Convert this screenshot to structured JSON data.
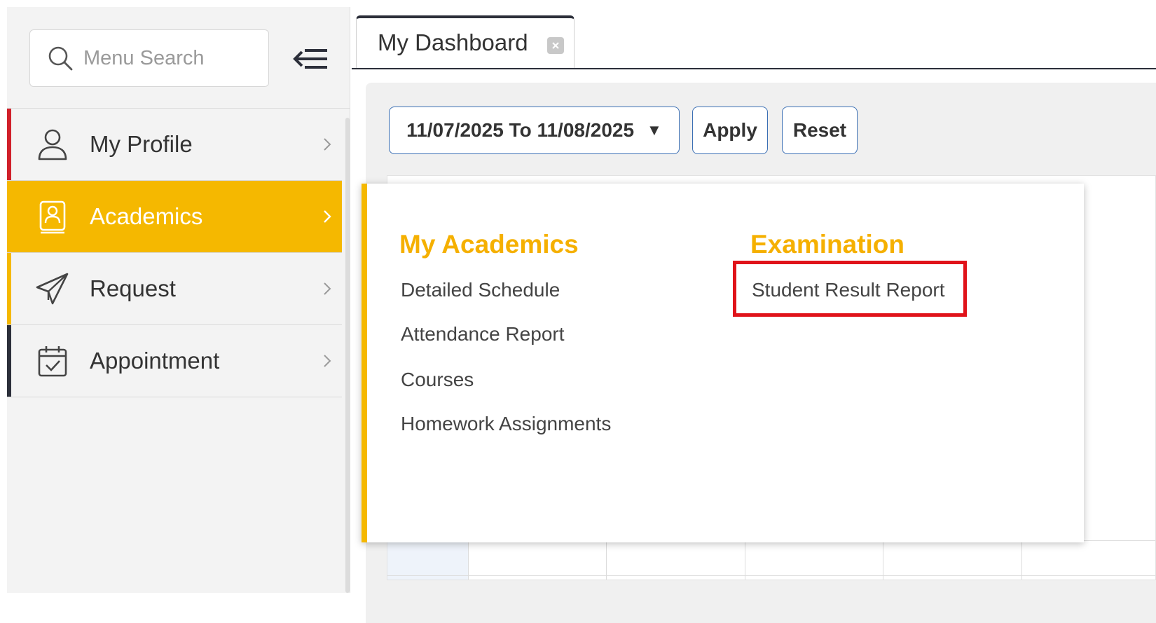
{
  "sidebar": {
    "search_placeholder": "Menu Search",
    "items": [
      {
        "label": "My Profile",
        "icon": "user-icon",
        "accent": "#d0202a"
      },
      {
        "label": "Academics",
        "icon": "academics-book-icon",
        "accent": "#f5b800"
      },
      {
        "label": "Request",
        "icon": "paper-plane-icon",
        "accent": "#f5b800"
      },
      {
        "label": "Appointment",
        "icon": "calendar-check-icon",
        "accent": "#2c2f3a"
      }
    ]
  },
  "tabs": [
    {
      "label": "My Dashboard"
    }
  ],
  "filters": {
    "date_range": "11/07/2025 To 11/08/2025",
    "caret": "▼",
    "apply_label": "Apply",
    "reset_label": "Reset"
  },
  "popup": {
    "columns": [
      {
        "title": "My Academics",
        "links": [
          "Detailed Schedule",
          "Attendance Report",
          "Courses",
          "Homework Assignments"
        ]
      },
      {
        "title": "Examination",
        "links": [
          "Student Result Report"
        ]
      }
    ]
  },
  "colors": {
    "accent": "#f5b800",
    "highlight": "#e0131a",
    "button_border": "#3b6fb4"
  }
}
